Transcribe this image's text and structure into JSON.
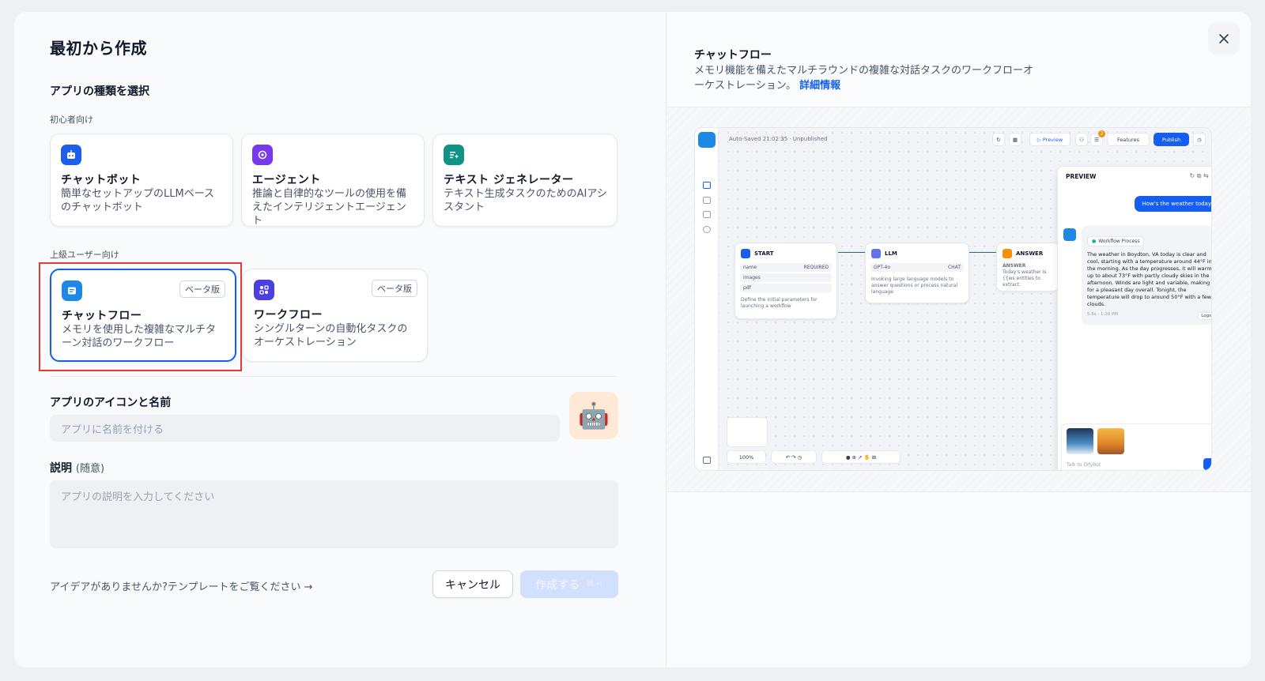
{
  "left": {
    "title": "最初から作成",
    "choose_type_label": "アプリの種類を選択",
    "beginner_label": "初心者向け",
    "advanced_label": "上級ユーザー向け",
    "beginner_cards": [
      {
        "title": "チャットボット",
        "desc": "簡単なセットアップのLLMベースのチャットボット",
        "icon": "chatbot-icon",
        "color": "#1e5eef"
      },
      {
        "title": "エージェント",
        "desc": "推論と自律的なツールの使用を備えたインテリジェントエージェント",
        "icon": "agent-icon",
        "color": "#7839ee"
      },
      {
        "title": "テキスト ジェネレーター",
        "desc": "テキスト生成タスクのためのAIアシスタント",
        "icon": "text-generator-icon",
        "color": "#0e9384"
      }
    ],
    "advanced_cards": [
      {
        "title": "チャットフロー",
        "desc": "メモリを使用した複雑なマルチターン対話のワークフロー",
        "badge": "ベータ版",
        "icon": "chatflow-icon",
        "color": "#1e88e5",
        "selected": true
      },
      {
        "title": "ワークフロー",
        "desc": "シングルターンの自動化タスクのオーケストレーション",
        "badge": "ベータ版",
        "icon": "workflow-icon",
        "color": "#4c3fe0"
      }
    ],
    "icon_name_label": "アプリのアイコンと名前",
    "name_placeholder": "アプリに名前を付ける",
    "desc_label": "説明",
    "desc_optional": "(随意)",
    "desc_placeholder": "アプリの説明を入力してください",
    "template_link": "アイデアがありませんか?テンプレートをご覧ください →",
    "cancel_label": "キャンセル",
    "create_label": "作成する",
    "create_shortcut": "⌘ ↵",
    "app_icon_emoji": "🤖"
  },
  "right": {
    "title": "チャットフロー",
    "desc": "メモリ機能を備えたマルチラウンドの複雑な対話タスクのワークフローオーケストレーション。",
    "more_link": "詳細情報",
    "preview": {
      "status": "Auto-Saved 21:02:35 · Unpublished",
      "preview_btn": "▷ Preview",
      "features_btn": "Features",
      "publish_btn": "Publish",
      "badge_count": "2",
      "zoom": "100%",
      "nodes": {
        "start": {
          "title": "START",
          "rows": [
            "name",
            "images",
            "pdf"
          ],
          "required": "REQUIRED",
          "desc": "Define the initial parameters for launching a workflow"
        },
        "llm": {
          "title": "LLM",
          "model": "GPT-4o",
          "mode": "CHAT",
          "desc": "Invoking large language models to answer questions or process natural language"
        },
        "answer": {
          "title": "ANSWER",
          "label": "ANSWER",
          "desc": "Today's weather is {{ws entities to extract."
        }
      },
      "chat": {
        "title": "PREVIEW",
        "user_msg": "How's the weather today",
        "workflow_process": "Workflow Process",
        "bot_msg": "The weather in Boydton, VA today is clear and cool, starting with a temperature around 44°F in the morning. As the day progresses, it will warm up to about 73°F with partly cloudy skies in the afternoon. Winds are light and variable, making for a pleasant day overall. Tonight, the temperature will drop to around 50°F with a few clouds.",
        "meta": "5.6s · 1:20 PM",
        "logs": "Logs",
        "input_placeholder": "Talk to DifyBot"
      }
    }
  }
}
